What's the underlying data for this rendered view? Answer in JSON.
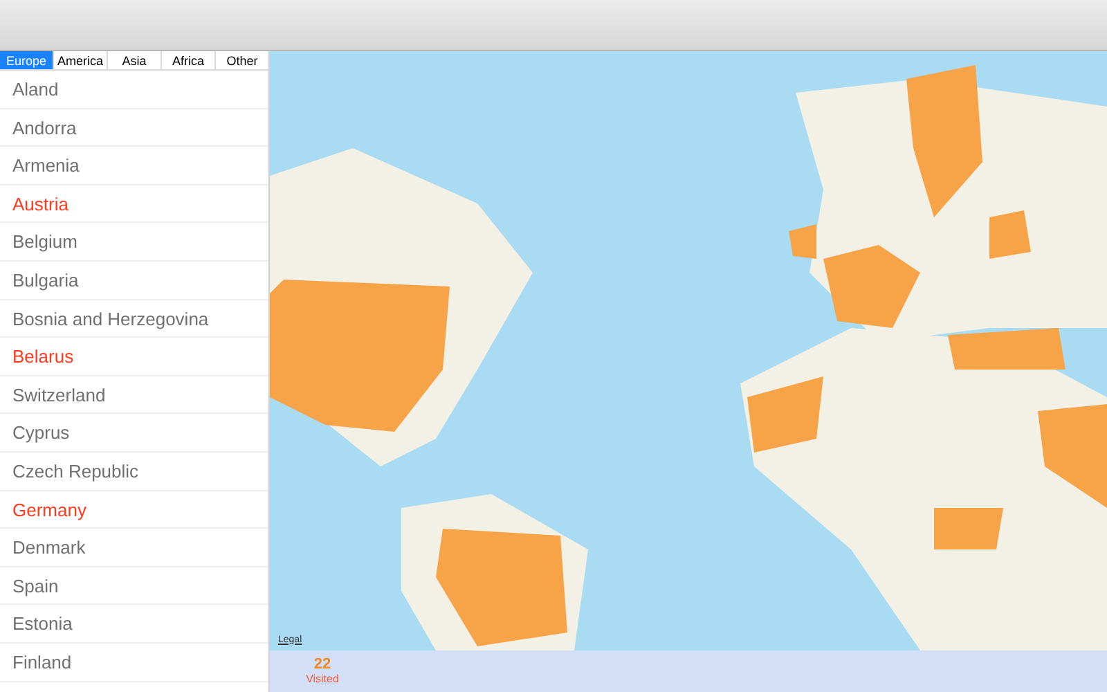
{
  "tabs": [
    {
      "label": "Europe",
      "selected": true
    },
    {
      "label": "America",
      "selected": false
    },
    {
      "label": "Asia",
      "selected": false
    },
    {
      "label": "Africa",
      "selected": false
    },
    {
      "label": "Other",
      "selected": false
    }
  ],
  "countries": [
    {
      "name": "Aland",
      "visited": false
    },
    {
      "name": "Andorra",
      "visited": false
    },
    {
      "name": "Armenia",
      "visited": false
    },
    {
      "name": "Austria",
      "visited": true
    },
    {
      "name": "Belgium",
      "visited": false
    },
    {
      "name": "Bulgaria",
      "visited": false
    },
    {
      "name": "Bosnia and Herzegovina",
      "visited": false
    },
    {
      "name": "Belarus",
      "visited": true
    },
    {
      "name": "Switzerland",
      "visited": false
    },
    {
      "name": "Cyprus",
      "visited": false
    },
    {
      "name": "Czech Republic",
      "visited": false
    },
    {
      "name": "Germany",
      "visited": true
    },
    {
      "name": "Denmark",
      "visited": false
    },
    {
      "name": "Spain",
      "visited": false
    },
    {
      "name": "Estonia",
      "visited": false
    },
    {
      "name": "Finland",
      "visited": false
    }
  ],
  "map": {
    "kind": "picture",
    "legal_link": "Legal"
  },
  "stats": {
    "count": "22",
    "label": "Visited"
  }
}
